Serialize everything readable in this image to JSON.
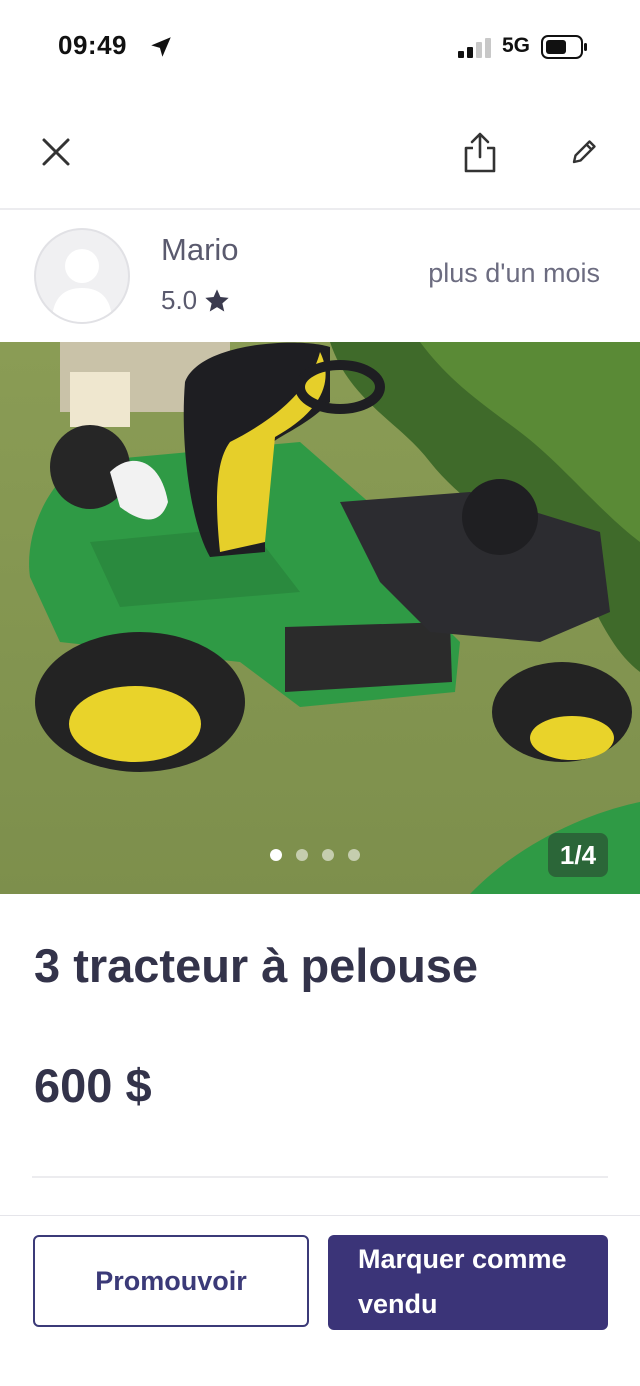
{
  "status_bar": {
    "time": "09:49",
    "network": "5G",
    "icons": [
      "location-arrow-icon",
      "signal-bars-icon",
      "battery-icon"
    ]
  },
  "nav": {
    "icons": [
      "close-icon",
      "share-icon",
      "edit-pencil-icon"
    ]
  },
  "seller": {
    "name": "Mario",
    "rating": "5.0",
    "rating_icon": "star-icon",
    "posted": "plus d'un mois"
  },
  "gallery": {
    "counter": "1/4",
    "total": 4,
    "current": 1
  },
  "listing": {
    "title": "3 tracteur à pelouse",
    "price": "600 $"
  },
  "actions": {
    "promote_label": "Promouvoir",
    "mark_sold_label": "Marquer comme vendu"
  },
  "colors": {
    "brand": "#3b3478",
    "text": "#33334a"
  }
}
